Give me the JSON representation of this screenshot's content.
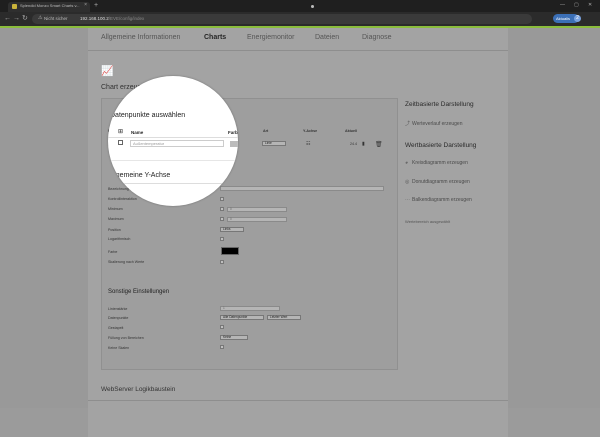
{
  "browser": {
    "tab_title": "Splendid Monzo Smart Charts v...",
    "tab_close": "×",
    "new_tab": "+",
    "insecure_label": "Nicht sicher",
    "url_host": "192.168.100.2",
    "url_path": "/EVE/config/index",
    "update_button": "Aktualis",
    "profile_initial": "2"
  },
  "nav": {
    "tabs": [
      "Allgemeine Informationen",
      "Charts",
      "Energiemonitor",
      "Dateien",
      "Diagnose"
    ],
    "active": "Charts"
  },
  "page": {
    "heading": "Chart erzeugen"
  },
  "datapoints": {
    "heading": "Datenpunkte auswählen",
    "col_id": "ID",
    "col_name": "Name",
    "col_color": "Farbe",
    "col_type": "Art",
    "col_yaxis": "Y-Achse",
    "col_current": "Aktuell",
    "row": {
      "name_placeholder": "Außentemperatur",
      "type_value": "Linie",
      "current_value": "24.4"
    }
  },
  "yaxis": {
    "heading": "Allgemeine Y-Achse",
    "labels": [
      "Bezeichnung",
      "Kontrollinteraktion",
      "Minimum",
      "Maximum",
      "Position",
      "Logarithmisch",
      "Farbe",
      "Skalierung nach Werte"
    ],
    "minimum_value": "0",
    "maximum_value": "0",
    "position_value": "Links",
    "color_value": "#000000"
  },
  "other": {
    "heading": "Sonstige Einstellungen",
    "labels": [
      "Linienstärke",
      "Datenpunkte",
      "Gestapelt",
      "Füllung von Bereichen",
      "Keine Skalen"
    ],
    "linewidth_value": "1",
    "datapoints_select_a": "Alle Datenpunkte",
    "datapoints_select_b": "Letzter Wert",
    "fill_value": "Keine"
  },
  "sidebar": {
    "time_heading": "Zeitbasierte Darstellung",
    "time_items": [
      {
        "icon": "trend-icon",
        "label": "Werteverlauf erzeugen"
      }
    ],
    "value_heading": "Wertbasierte Darstellung",
    "value_items": [
      {
        "icon": "pie-icon",
        "label": "Kreisdiagramm erzeugen"
      },
      {
        "icon": "donut-icon",
        "label": "Donutdiagramm erzeugen"
      },
      {
        "icon": "bar-icon",
        "label": "Balkendiagramm erzeugen"
      }
    ],
    "note": "Wertebereich ausgewählt"
  },
  "footer": {
    "heading": "WebServer Logikbaustein"
  },
  "colors": {
    "accent": "#8bbd3c",
    "update_button": "#3b6fb6"
  }
}
